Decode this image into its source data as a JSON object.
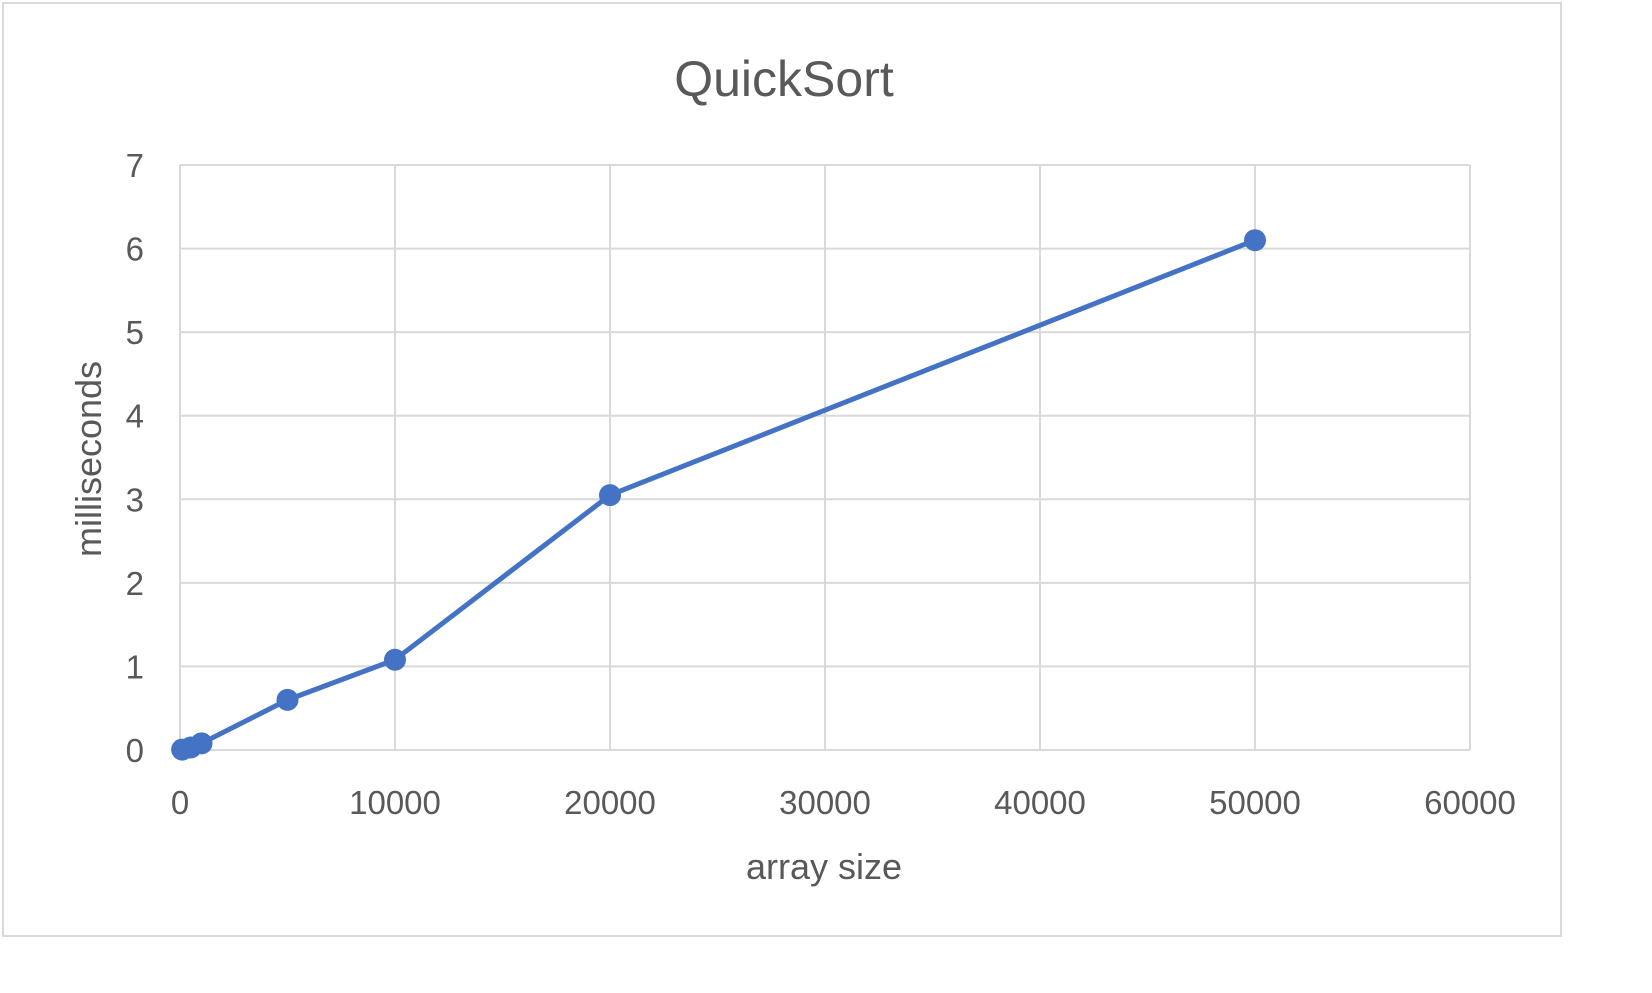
{
  "chart_data": {
    "type": "scatter",
    "title": "QuickSort",
    "xlabel": "array size",
    "ylabel": "milliseconds",
    "xlim": [
      0,
      60000
    ],
    "ylim": [
      0,
      7
    ],
    "xticks": [
      "0",
      "10000",
      "20000",
      "30000",
      "40000",
      "50000",
      "60000"
    ],
    "yticks": [
      "0",
      "1",
      "2",
      "3",
      "4",
      "5",
      "6",
      "7"
    ],
    "grid": true,
    "legend": "none",
    "series": [
      {
        "color": "#4472c4",
        "lines": true,
        "markers": true,
        "points": [
          {
            "x": 100,
            "y": 0.005
          },
          {
            "x": 500,
            "y": 0.03
          },
          {
            "x": 1000,
            "y": 0.08
          },
          {
            "x": 5000,
            "y": 0.6
          },
          {
            "x": 10000,
            "y": 1.08
          },
          {
            "x": 20000,
            "y": 3.05
          },
          {
            "x": 50000,
            "y": 6.1
          }
        ]
      }
    ]
  }
}
